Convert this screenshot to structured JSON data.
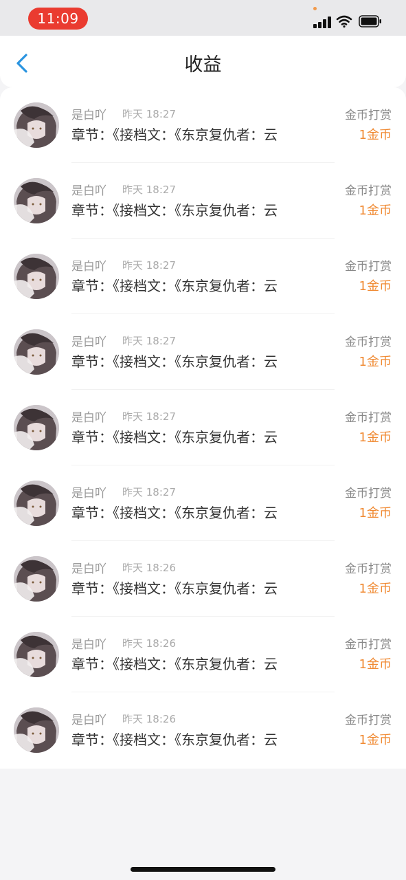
{
  "status_bar": {
    "time": "11:09"
  },
  "header": {
    "title": "收益",
    "back_icon": "chevron-left-icon"
  },
  "colors": {
    "accent": "#2a94e0",
    "amount": "#f08a33",
    "time_pill": "#ea3b30"
  },
  "rewards": [
    {
      "name": "是白吖",
      "time": "昨天 18:27",
      "type": "金币打赏",
      "chapter": "章节：《接档文：《东京复仇者：云",
      "amount": "1金币"
    },
    {
      "name": "是白吖",
      "time": "昨天 18:27",
      "type": "金币打赏",
      "chapter": "章节：《接档文：《东京复仇者：云",
      "amount": "1金币"
    },
    {
      "name": "是白吖",
      "time": "昨天 18:27",
      "type": "金币打赏",
      "chapter": "章节：《接档文：《东京复仇者：云",
      "amount": "1金币"
    },
    {
      "name": "是白吖",
      "time": "昨天 18:27",
      "type": "金币打赏",
      "chapter": "章节：《接档文：《东京复仇者：云",
      "amount": "1金币"
    },
    {
      "name": "是白吖",
      "time": "昨天 18:27",
      "type": "金币打赏",
      "chapter": "章节：《接档文：《东京复仇者：云",
      "amount": "1金币"
    },
    {
      "name": "是白吖",
      "time": "昨天 18:27",
      "type": "金币打赏",
      "chapter": "章节：《接档文：《东京复仇者：云",
      "amount": "1金币"
    },
    {
      "name": "是白吖",
      "time": "昨天 18:26",
      "type": "金币打赏",
      "chapter": "章节：《接档文：《东京复仇者：云",
      "amount": "1金币"
    },
    {
      "name": "是白吖",
      "time": "昨天 18:26",
      "type": "金币打赏",
      "chapter": "章节：《接档文：《东京复仇者：云",
      "amount": "1金币"
    },
    {
      "name": "是白吖",
      "time": "昨天 18:26",
      "type": "金币打赏",
      "chapter": "章节：《接档文：《东京复仇者：云",
      "amount": "1金币"
    }
  ]
}
